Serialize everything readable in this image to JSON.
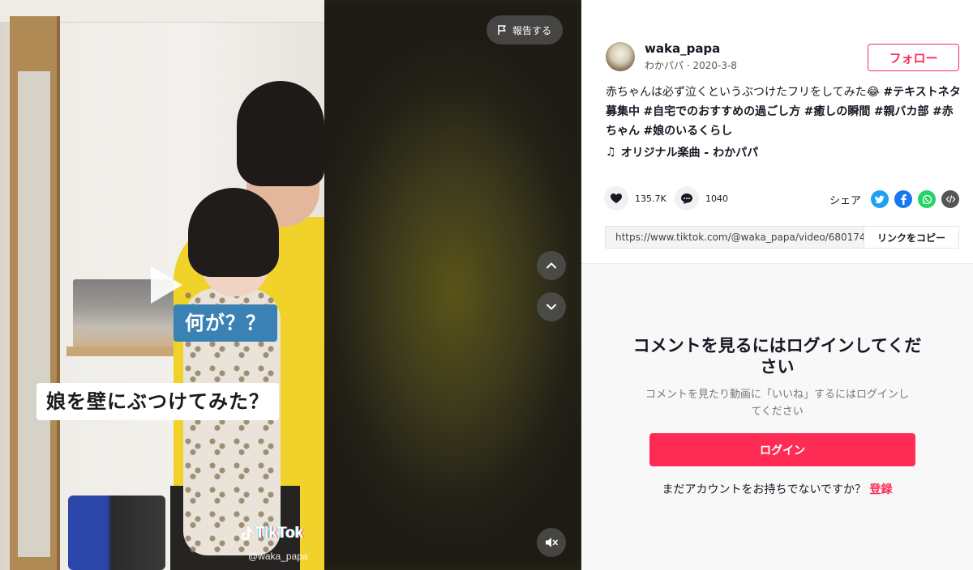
{
  "video": {
    "caption_question": "何が？？",
    "caption_main": "娘を壁にぶつけてみた？",
    "watermark_brand": "TikTok",
    "watermark_handle": "@waka_papa"
  },
  "controls": {
    "report_label": "報告する"
  },
  "author": {
    "username": "waka_papa",
    "meta": "わかパパ · 2020-3-8",
    "follow_label": "フォロー"
  },
  "description": {
    "text": "赤ちゃんは必ず泣くというぶつけたフリをしてみた😂 ",
    "tags": [
      "#テキストネタ募集中",
      "#自宅でのおすすめの過ごし方",
      "#癒しの瞬間",
      "#親バカ部",
      "#赤ちゃん",
      "#娘のいるくらし"
    ]
  },
  "music": {
    "label": "オリジナル楽曲 - わかパパ"
  },
  "stats": {
    "likes": "135.7K",
    "comments": "1040"
  },
  "share": {
    "label": "シェア"
  },
  "link": {
    "url": "https://www.tiktok.com/@waka_papa/video/680174...",
    "copy_label": "リンクをコピー"
  },
  "login_prompt": {
    "title": "コメントを見るにはログインしてください",
    "subtitle": "コメントを見たり動画に「いいね」するにはログインしてください",
    "button_label": "ログイン",
    "signup_text": "まだアカウントをお持ちでないですか？",
    "signup_link": "登録"
  },
  "colors": {
    "accent": "#fe2c55",
    "text": "#161823",
    "caption_blue": "#3b82b4"
  }
}
